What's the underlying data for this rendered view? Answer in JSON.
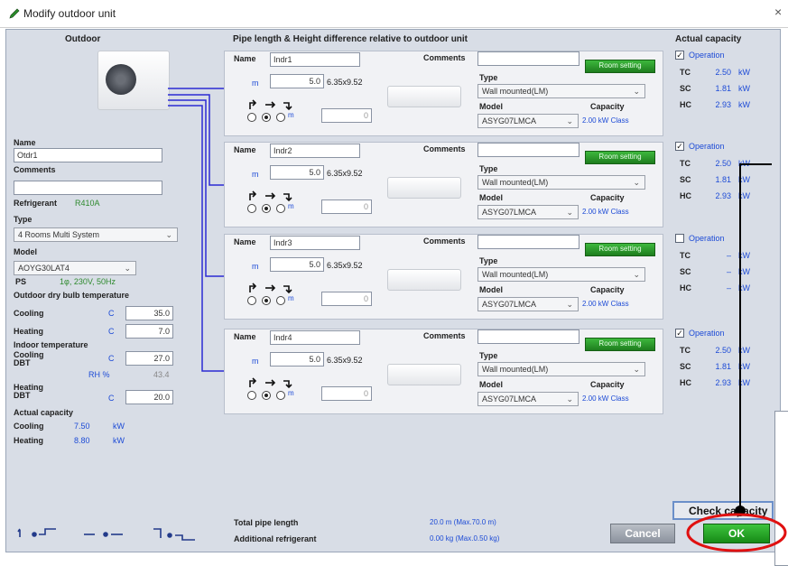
{
  "window": {
    "title": "Modify outdoor unit",
    "close": "×"
  },
  "headers": {
    "outdoor": "Outdoor",
    "pipe": "Pipe length & Height difference relative to outdoor unit",
    "actual": "Actual capacity"
  },
  "outdoor": {
    "name_label": "Name",
    "name_value": "Otdr1",
    "comments_label": "Comments",
    "comments_value": "",
    "refrigerant_label": "Refrigerant",
    "refrigerant_value": "R410A",
    "type_label": "Type",
    "type_value": "4 Rooms Multi System",
    "model_label": "Model",
    "model_value": "AOYG30LAT4",
    "ps_label": "PS",
    "ps_value": "1φ, 230V, 50Hz",
    "odbt_label": "Outdoor dry bulb temperature",
    "cooling_label": "Cooling",
    "cooling_unit": "C",
    "cooling_value": "35.0",
    "heating_label": "Heating",
    "heating_unit": "C",
    "heating_value": "7.0",
    "indoor_temp_label": "Indoor temperature",
    "icool_label": "Cooling\nDBT",
    "icool_unit": "C",
    "icool_value": "27.0",
    "rh_label": "RH %",
    "rh_value": "43.4",
    "iheat_label": "Heating\nDBT",
    "iheat_unit": "C",
    "iheat_value": "20.0",
    "actcap_label": "Actual capacity",
    "cap_cool_label": "Cooling",
    "cap_cool_value": "7.50",
    "cap_cool_unit": "kW",
    "cap_heat_label": "Heating",
    "cap_heat_value": "8.80",
    "cap_heat_unit": "kW"
  },
  "indoor_common": {
    "name_label": "Name",
    "comments_label": "Comments",
    "room_setting": "Room setting",
    "m_label": "m",
    "type_label": "Type",
    "model_label": "Model",
    "capacity_label": "Capacity",
    "height_unit": "m",
    "pipe_size": "6.35x9.52"
  },
  "indoors": [
    {
      "name": "Indr1",
      "length": "5.0",
      "height": "0",
      "type": "Wall mounted(LM)",
      "model": "ASYG07LMCA",
      "capacity": "2.00 kW Class"
    },
    {
      "name": "Indr2",
      "length": "5.0",
      "height": "0",
      "type": "Wall mounted(LM)",
      "model": "ASYG07LMCA",
      "capacity": "2.00 kW Class"
    },
    {
      "name": "Indr3",
      "length": "5.0",
      "height": "0",
      "type": "Wall mounted(LM)",
      "model": "ASYG07LMCA",
      "capacity": "2.00 kW Class"
    },
    {
      "name": "Indr4",
      "length": "5.0",
      "height": "0",
      "type": "Wall mounted(LM)",
      "model": "ASYG07LMCA",
      "capacity": "2.00 kW Class"
    }
  ],
  "capacity_common": {
    "operation": "Operation",
    "tc": "TC",
    "sc": "SC",
    "hc": "HC",
    "unit": "kW"
  },
  "capacities": [
    {
      "checked": "✓",
      "tc": "2.50",
      "sc": "1.81",
      "hc": "2.93"
    },
    {
      "checked": "✓",
      "tc": "2.50",
      "sc": "1.81",
      "hc": "2.93"
    },
    {
      "checked": "",
      "tc": "–",
      "sc": "–",
      "hc": "–"
    },
    {
      "checked": "✓",
      "tc": "2.50",
      "sc": "1.81",
      "hc": "2.93"
    }
  ],
  "footer": {
    "total_label": "Total pipe length",
    "total_value": "20.0 m (Max.70.0 m)",
    "addref_label": "Additional refrigerant",
    "addref_value": "0.00 kg (Max.0.50 kg)",
    "cancel": "Cancel",
    "check": "Check capacity",
    "ok": "OK"
  },
  "colors": {
    "pipe": "#2b2bd4",
    "annotation": "#e01010",
    "accent": "#1d8f1d"
  }
}
